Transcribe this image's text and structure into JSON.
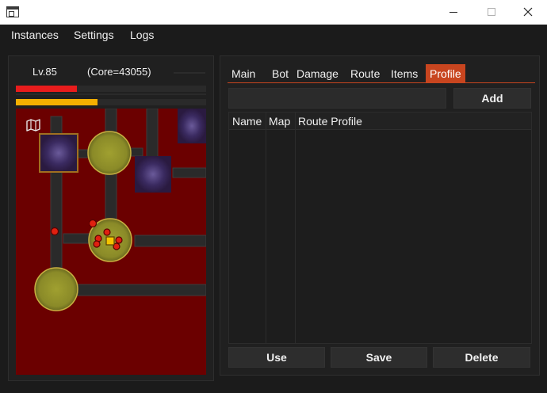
{
  "window": {
    "minimize_icon": "minimize-icon",
    "maximize_icon": "maximize-icon",
    "close_icon": "close-icon"
  },
  "menu": [
    "Instances",
    "Settings",
    "Logs"
  ],
  "status": {
    "level": "Lv.85",
    "core": "(Core=43055)",
    "hp_fraction": 0.32,
    "exp_fraction": 0.43,
    "hp_color": "#e81c1c",
    "exp_color": "#f5b000"
  },
  "map": {
    "icon": "map-icon",
    "background_color": "#6b0000"
  },
  "tabs": {
    "items": [
      "Main",
      "Bot",
      "Damage",
      "Route",
      "Items",
      "Profile"
    ],
    "active": "Profile",
    "accent_color": "#c8451f"
  },
  "profile": {
    "name_value": "",
    "add_label": "Add",
    "columns": [
      "Name",
      "Map",
      "Route Profile"
    ],
    "rows": [],
    "use_label": "Use",
    "save_label": "Save",
    "delete_label": "Delete"
  }
}
